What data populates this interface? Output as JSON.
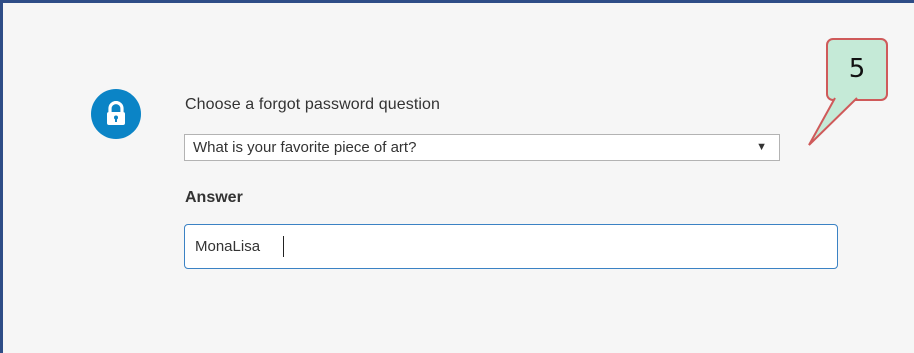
{
  "icons": {
    "lock": "lock-icon",
    "dropdown": "dropdown-arrow-icon"
  },
  "colors": {
    "accent": "#0b84c6",
    "frame_border": "#2e4d87",
    "input_focus": "#3b82c4",
    "callout_fill": "#c5ead7",
    "callout_border": "#cf5a5a"
  },
  "form": {
    "question_label": "Choose a forgot password question",
    "question_selected": "What is your favorite piece of art?",
    "answer_label": "Answer",
    "answer_value": "MonaLisa"
  },
  "annotation": {
    "step_number": "5"
  }
}
